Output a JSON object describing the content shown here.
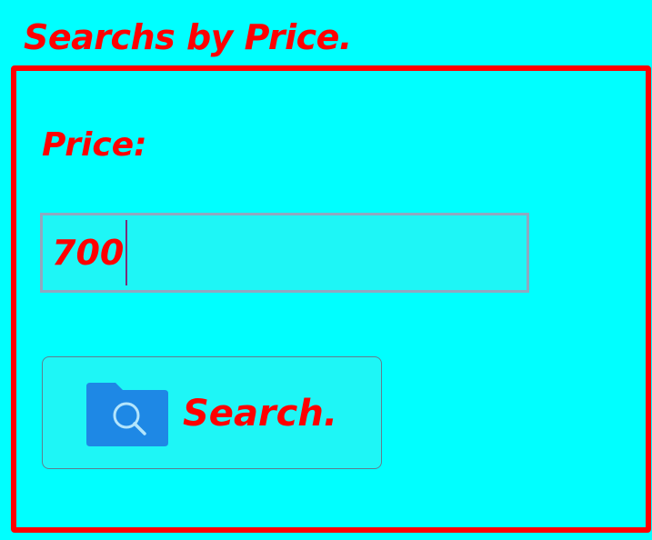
{
  "group": {
    "title": "Searchs by Price."
  },
  "price": {
    "label": "Price:",
    "value": "700"
  },
  "search_button": {
    "label": "Search.",
    "icon": "folder-search-icon"
  },
  "colors": {
    "background": "#00FFFF",
    "text": "#FF0000",
    "border": "#FF0000",
    "icon": "#1E88E5"
  }
}
